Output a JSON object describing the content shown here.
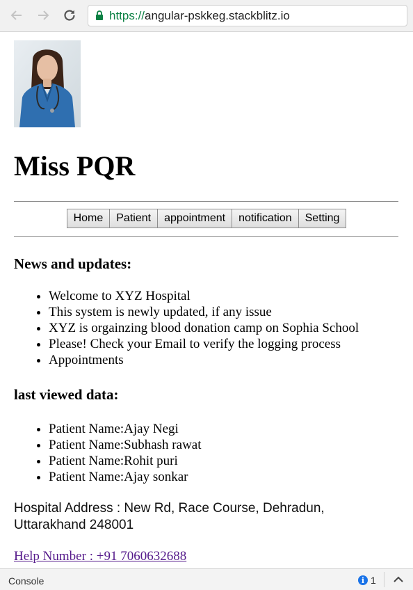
{
  "browser": {
    "url_scheme": "https://",
    "url_host": "angular-pskkeg.stackblitz.io"
  },
  "profile": {
    "name": "Miss PQR"
  },
  "nav": {
    "items": [
      "Home",
      "Patient",
      "appointment",
      "notification",
      "Setting"
    ]
  },
  "news": {
    "heading": "News and updates:",
    "items": [
      "Welcome to XYZ Hospital",
      "This system is newly updated, if any issue",
      "XYZ is orgainzing blood donation camp on Sophia School",
      "Please! Check your Email to verify the logging process",
      "Appointments"
    ]
  },
  "last_viewed": {
    "heading": "last viewed data:",
    "items": [
      "Patient Name:Ajay Negi",
      "Patient Name:Subhash rawat",
      "Patient Name:Rohit puri",
      "Patient Name:Ajay sonkar"
    ]
  },
  "address": {
    "line1": "Hospital Address : New Rd, Race Course, Dehradun,",
    "line2": "Uttarakhand 248001"
  },
  "help": {
    "label": "Help Number : +91 7060632688"
  },
  "console": {
    "label": "Console",
    "info_count": "1"
  },
  "colors": {
    "link_visited": "#551a8b",
    "secure_green": "#0b8043",
    "info_blue": "#1a73e8"
  }
}
